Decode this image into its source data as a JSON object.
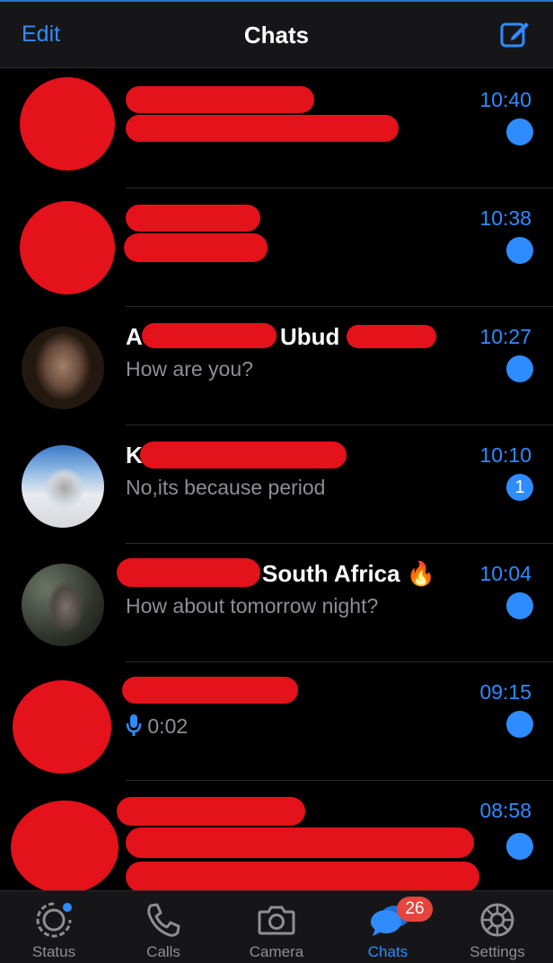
{
  "header": {
    "edit_label": "Edit",
    "title": "Chats"
  },
  "chats": [
    {
      "name": "",
      "message": "",
      "time": "10:40",
      "unread": ""
    },
    {
      "name": "",
      "message": "",
      "time": "10:38",
      "unread": ""
    },
    {
      "name_prefix": "A",
      "name_suffix": "Ubud",
      "message": "How are you?",
      "time": "10:27",
      "unread": ""
    },
    {
      "name_prefix": "K",
      "message": "No,its because period",
      "time": "10:10",
      "unread": "1"
    },
    {
      "name_suffix": "South Africa",
      "name_emoji": "🔥",
      "message": "How about tomorrow night?",
      "time": "10:04",
      "unread": ""
    },
    {
      "name": "",
      "voice_duration": "0:02",
      "time": "09:15",
      "unread": ""
    },
    {
      "name": "",
      "message": "",
      "time": "08:58",
      "unread": ""
    }
  ],
  "tabs": [
    {
      "label": "Status"
    },
    {
      "label": "Calls"
    },
    {
      "label": "Camera"
    },
    {
      "label": "Chats",
      "badge": "26"
    },
    {
      "label": "Settings"
    }
  ],
  "colors": {
    "accent": "#2f8cff",
    "redaction": "#e3121b",
    "badge": "#e5453d"
  }
}
